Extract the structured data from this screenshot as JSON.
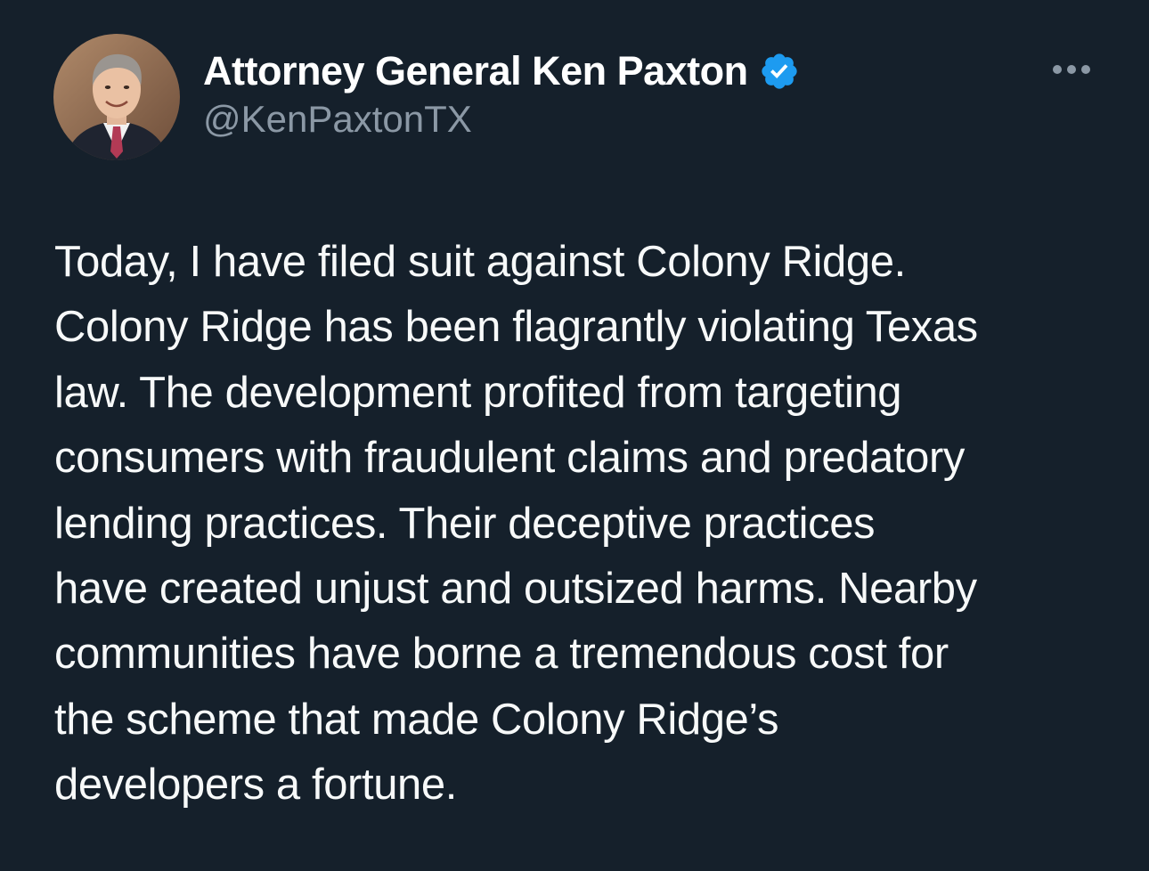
{
  "author": {
    "display_name": "Attorney General Ken Paxton",
    "handle": "@KenPaxtonTX",
    "verified": true,
    "avatar_icon": "profile-photo",
    "badge_icon": "verified-badge-icon",
    "badge_color": "#1d9bf0"
  },
  "menu": {
    "icon": "more-options-icon"
  },
  "tweet": {
    "lines": [
      "Today, I have filed suit against Colony Ridge.",
      "Colony Ridge has been flagrantly violating Texas",
      "law. The development profited from targeting",
      "consumers with fraudulent claims and predatory",
      "lending practices. Their deceptive practices",
      "have created unjust and outsized harms. Nearby",
      "communities have borne a tremendous cost for",
      "the scheme that made Colony Ridge’s",
      "developers a fortune."
    ]
  },
  "colors": {
    "background": "#15202b",
    "text_primary": "#f7f9f9",
    "text_secondary": "#8b98a5",
    "accent": "#1d9bf0"
  }
}
